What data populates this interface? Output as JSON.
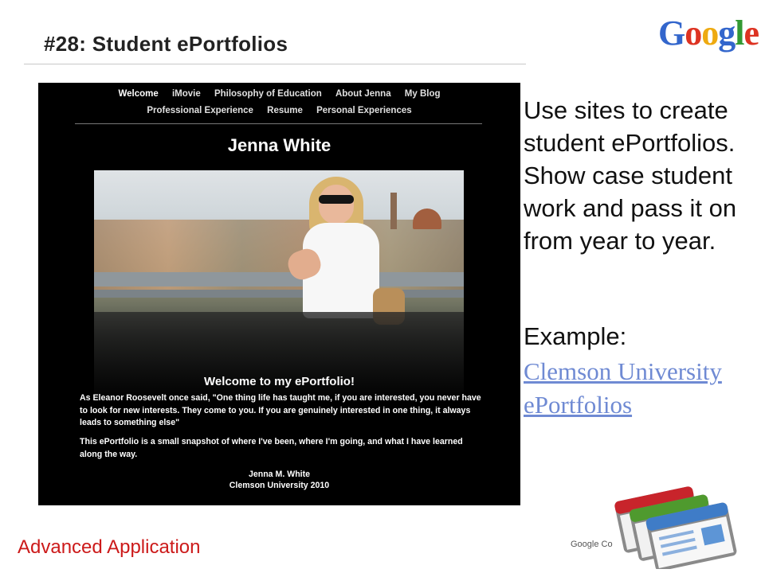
{
  "slide": {
    "title": "#28: Student ePortfolios",
    "body": "Use sites to create student ePortfolios.  Show case student work and pass it on from year to year.",
    "example_label": "Example:",
    "example_link": "Clemson University ePortfolios",
    "footer_label": "Advanced Application",
    "footer_confidential": "Google Co"
  },
  "logo": {
    "letters": [
      {
        "char": "G",
        "color": "#3366cc"
      },
      {
        "char": "o",
        "color": "#dd3322"
      },
      {
        "char": "o",
        "color": "#eeaa11"
      },
      {
        "char": "g",
        "color": "#3366cc"
      },
      {
        "char": "l",
        "color": "#339933"
      },
      {
        "char": "e",
        "color": "#dd3322"
      }
    ]
  },
  "site": {
    "nav_row1": [
      "Welcome",
      "iMovie",
      "Philosophy of Education",
      "About Jenna",
      "My Blog"
    ],
    "nav_row2": [
      "Professional Experience",
      "Resume",
      "Personal Experiences"
    ],
    "heading": "Jenna White",
    "welcome_heading": "Welcome to my ePortfolio!",
    "paragraph1": "As Eleanor Roosevelt once said, \"One thing life has taught me, if you are interested, you never have to look for new interests. They come to you. If you are genuinely interested in one thing, it always leads to something else\"",
    "paragraph2": "This ePortfolio is a small snapshot of where I've been, where I'm going, and what I have learned along the way.",
    "signature_name": "Jenna M. White",
    "signature_school": "Clemson University 2010"
  },
  "colors": {
    "footer_red": "#cc1a1a",
    "link_blue": "#6f8ad3",
    "icon_red": "#c8242b",
    "icon_green": "#4f9a2e",
    "icon_blue": "#3f7cc7"
  }
}
